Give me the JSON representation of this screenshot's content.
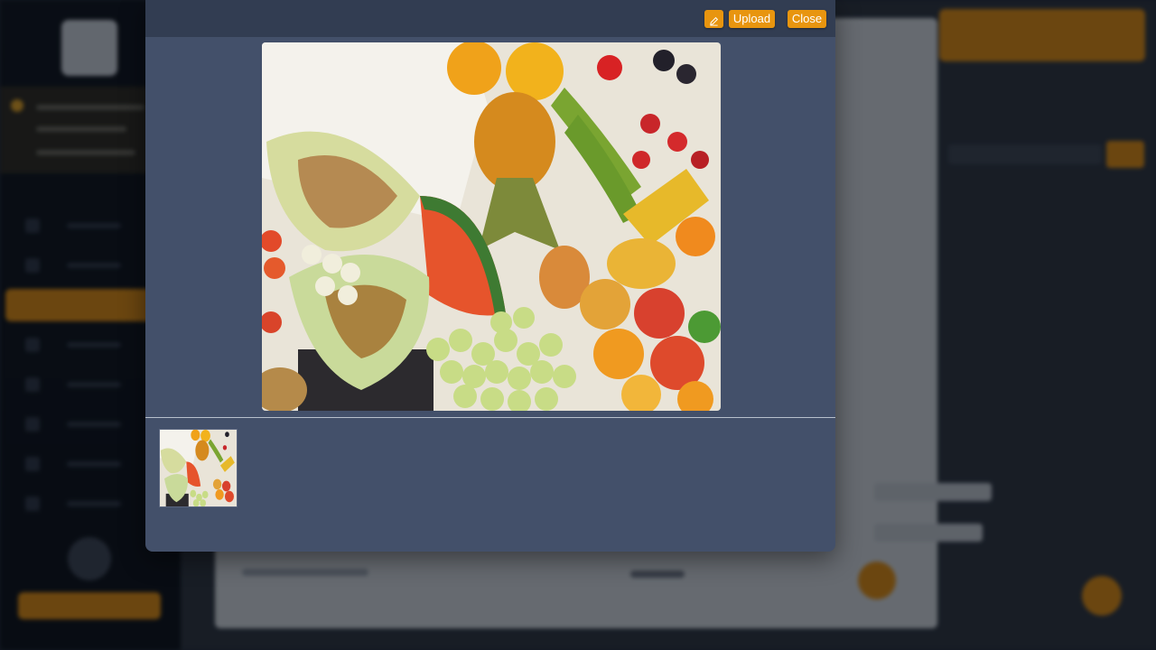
{
  "modal": {
    "buttons": {
      "edit_icon": "pencil-icon",
      "upload_label": "Upload",
      "close_label": "Close"
    },
    "preview_image": {
      "subject": "assorted-fruit-photo"
    },
    "thumbnails": [
      {
        "subject": "assorted-fruit-photo",
        "selected": true
      }
    ]
  },
  "colors": {
    "accent": "#e8950f",
    "modal_bg": "#43506a",
    "modal_toolbar_bg": "#323d52"
  }
}
